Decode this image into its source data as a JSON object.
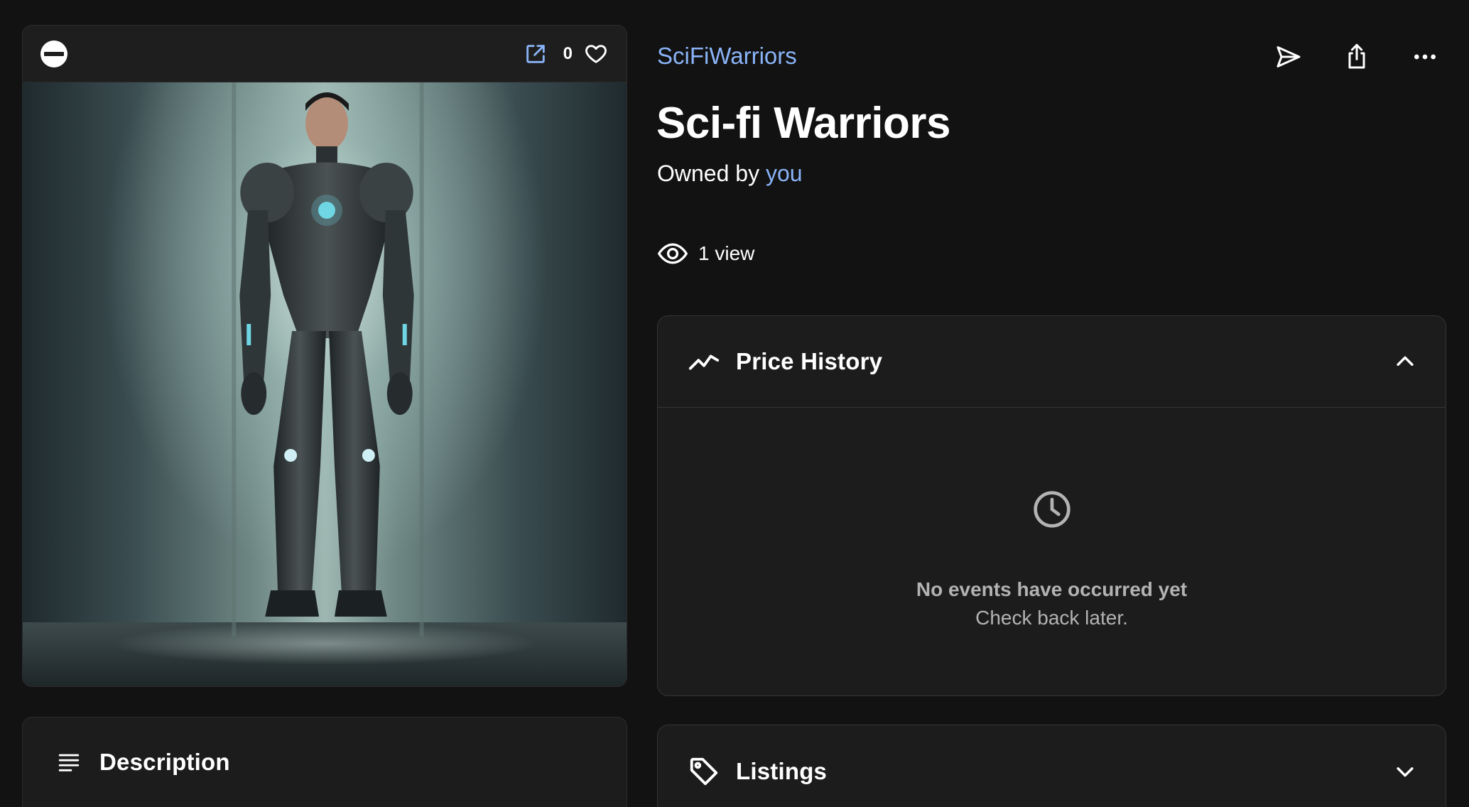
{
  "media": {
    "favorite_count": "0",
    "chain_icon": "chain-logo-icon",
    "external_icon": "external-link-icon",
    "favorite_icon": "heart-icon"
  },
  "item": {
    "collection": "SciFiWarriors",
    "title": "Sci-fi Warriors",
    "owned_prefix": "Owned by ",
    "owner": "you",
    "views": "1 view"
  },
  "actions": [
    "transfer-icon",
    "share-icon",
    "more-icon"
  ],
  "sections": {
    "description": {
      "title": "Description"
    },
    "price_history": {
      "title": "Price History",
      "empty_title": "No events have occurred yet",
      "empty_sub": "Check back later."
    },
    "listings": {
      "title": "Listings"
    }
  },
  "colors": {
    "background": "#121212",
    "card": "#1c1c1c",
    "link": "#8ab4f8",
    "muted": "#b3b3b3"
  }
}
